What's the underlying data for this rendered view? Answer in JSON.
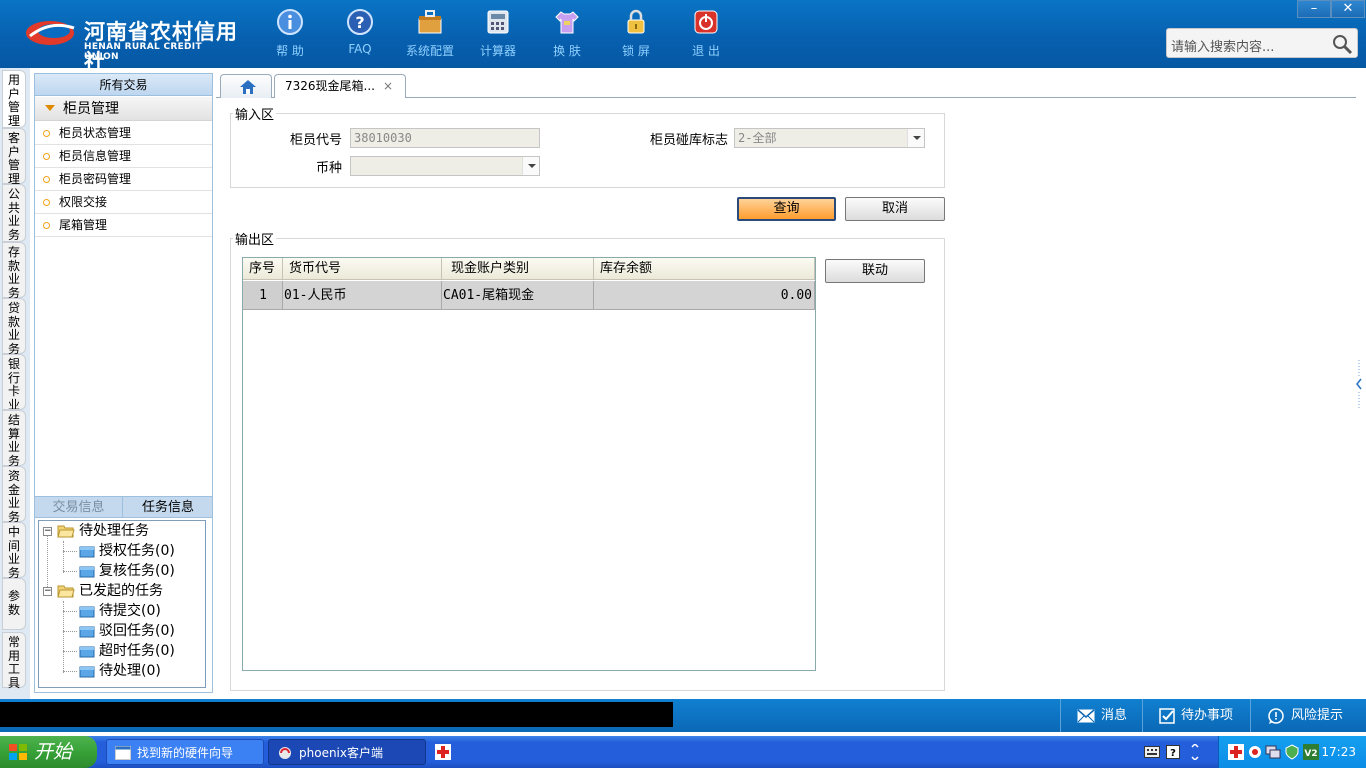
{
  "app": {
    "logo_cn": "河南省农村信用社",
    "logo_en": "HENAN RURAL CREDIT UNION"
  },
  "toolbar": {
    "help": "帮 助",
    "faq": "FAQ",
    "config": "系统配置",
    "calculator": "计算器",
    "skin": "换 肤",
    "lock": "锁 屏",
    "exit": "退 出"
  },
  "window": {
    "minimize": "–",
    "close": "✕"
  },
  "search": {
    "placeholder": "请输入搜索内容..."
  },
  "vtabs": [
    "用户管理",
    "客户管理",
    "公共业务",
    "存款业务",
    "贷款业务",
    "银行卡业务",
    "结算业务",
    "资金业务",
    "中间业务",
    "参数",
    "常用工具"
  ],
  "left_panel": {
    "title": "所有交易",
    "group": "柜员管理",
    "items": [
      "柜员状态管理",
      "柜员信息管理",
      "柜员密码管理",
      "权限交接",
      "尾箱管理"
    ],
    "info_tabs": [
      "交易信息",
      "任务信息"
    ],
    "tree": {
      "pending": "待处理任务",
      "pending_children": [
        "授权任务(0)",
        "复核任务(0)"
      ],
      "initiated": "已发起的任务",
      "initiated_children": [
        "待提交(0)",
        "驳回任务(0)",
        "超时任务(0)",
        "待处理(0)"
      ]
    }
  },
  "tabs": {
    "active_tab": "7326现金尾箱...",
    "close": "×"
  },
  "input_area": {
    "legend": "输入区",
    "teller_code_label": "柜员代号",
    "teller_code_value": "38010030",
    "vault_flag_label": "柜员碰库标志",
    "vault_flag_value": "2-全部",
    "currency_label": "币种",
    "currency_value": ""
  },
  "buttons": {
    "query": "查询",
    "cancel": "取消",
    "link": "联动"
  },
  "output_area": {
    "legend": "输出区",
    "columns": [
      "序号",
      "货币代号",
      "现金账户类别",
      "库存余额"
    ],
    "rows": [
      [
        "1",
        "01-人民币",
        "CA01-尾箱现金",
        "0.00"
      ]
    ]
  },
  "status_bar": {
    "messages": "消息",
    "todo": "待办事项",
    "risk": "风险提示"
  },
  "taskbar": {
    "start": "开始",
    "tasks": [
      "找到新的硬件向导",
      "phoenix客户端"
    ],
    "clock": "17:23"
  },
  "colors": {
    "header": "#0a74c5",
    "primary_button": "#ff9d2e",
    "taskbar": "#245edb"
  }
}
